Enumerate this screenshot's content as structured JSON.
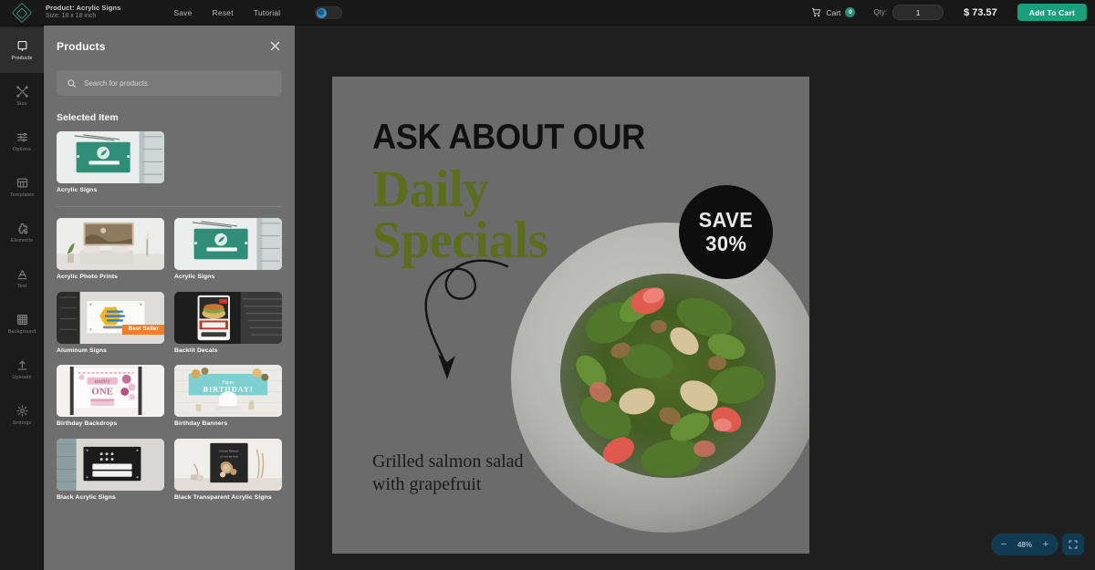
{
  "topbar": {
    "logo": "app-logo",
    "product_line": "Product: Acrylic Signs",
    "size_line": "Size: 18 x 18 inch",
    "save_label": "Save",
    "reset_label": "Reset",
    "tutorial_label": "Tutorial",
    "theme_toggle": "dark-mode-toggle",
    "cart_label": "Cart",
    "cart_count": "0",
    "qty_label": "Qty:",
    "qty_value": "1",
    "price": "$ 73.57",
    "add_to_cart_label": "Add To Cart",
    "accent_color": "#18a07c"
  },
  "rail": {
    "items": [
      {
        "label": "Products",
        "icon": "product-frame-icon",
        "active": true
      },
      {
        "label": "Size",
        "icon": "resize-icon",
        "active": false
      },
      {
        "label": "Options",
        "icon": "sliders-icon",
        "active": false
      },
      {
        "label": "Templates",
        "icon": "grid-template-icon",
        "active": false
      },
      {
        "label": "Elements",
        "icon": "puzzle-icon",
        "active": false
      },
      {
        "label": "Text",
        "icon": "letter-a-icon",
        "active": false
      },
      {
        "label": "Background",
        "icon": "checker-icon",
        "active": false
      },
      {
        "label": "Uploads",
        "icon": "upload-arrow-icon",
        "active": false
      },
      {
        "label": "Settings",
        "icon": "gear-icon",
        "active": false
      }
    ]
  },
  "panel": {
    "title": "Products",
    "close_icon": "close-icon",
    "search_placeholder": "Search for products",
    "search_value": "",
    "selected_section_title": "Selected Item",
    "selected_item": {
      "label": "Acrylic Signs",
      "art": "acrylic-green-sign"
    },
    "products": [
      {
        "label": "Acrylic Photo Prints",
        "art": "living-room-photo-print",
        "badge": ""
      },
      {
        "label": "Acrylic Signs",
        "art": "acrylic-green-sign",
        "badge": ""
      },
      {
        "label": "Aluminum Signs",
        "art": "aluminum-logo-sign",
        "badge": "Best Seller"
      },
      {
        "label": "Backlit Decals",
        "art": "backlit-food-decal",
        "badge": ""
      },
      {
        "label": "Birthday Backdrops",
        "art": "birthday-backdrop-pink",
        "badge": ""
      },
      {
        "label": "Birthday Banners",
        "art": "birthday-banner-teal",
        "badge": ""
      },
      {
        "label": "Black Acrylic Signs",
        "art": "black-tech-sign",
        "badge": ""
      },
      {
        "label": "Black Transparent Acrylic Signs",
        "art": "black-floral-poster",
        "badge": ""
      }
    ]
  },
  "canvas": {
    "artboard_bg": "#6b6b6b",
    "headline_small": "ASK ABOUT OUR",
    "headline_line1": "Daily",
    "headline_line2": "Specials",
    "headline_color": "#5c6e1e",
    "badge_line1": "SAVE",
    "badge_line2": "30%",
    "badge_bg": "#0e0e0e",
    "caption_line1": "Grilled salmon salad",
    "caption_line2": "with grapefruit",
    "decor": "curved-arrow-icon",
    "photo": "salmon-salad-plate"
  },
  "zoom": {
    "minus_label": "−",
    "value": "48%",
    "plus_label": "+",
    "fullscreen_icon": "fullscreen-icon"
  }
}
